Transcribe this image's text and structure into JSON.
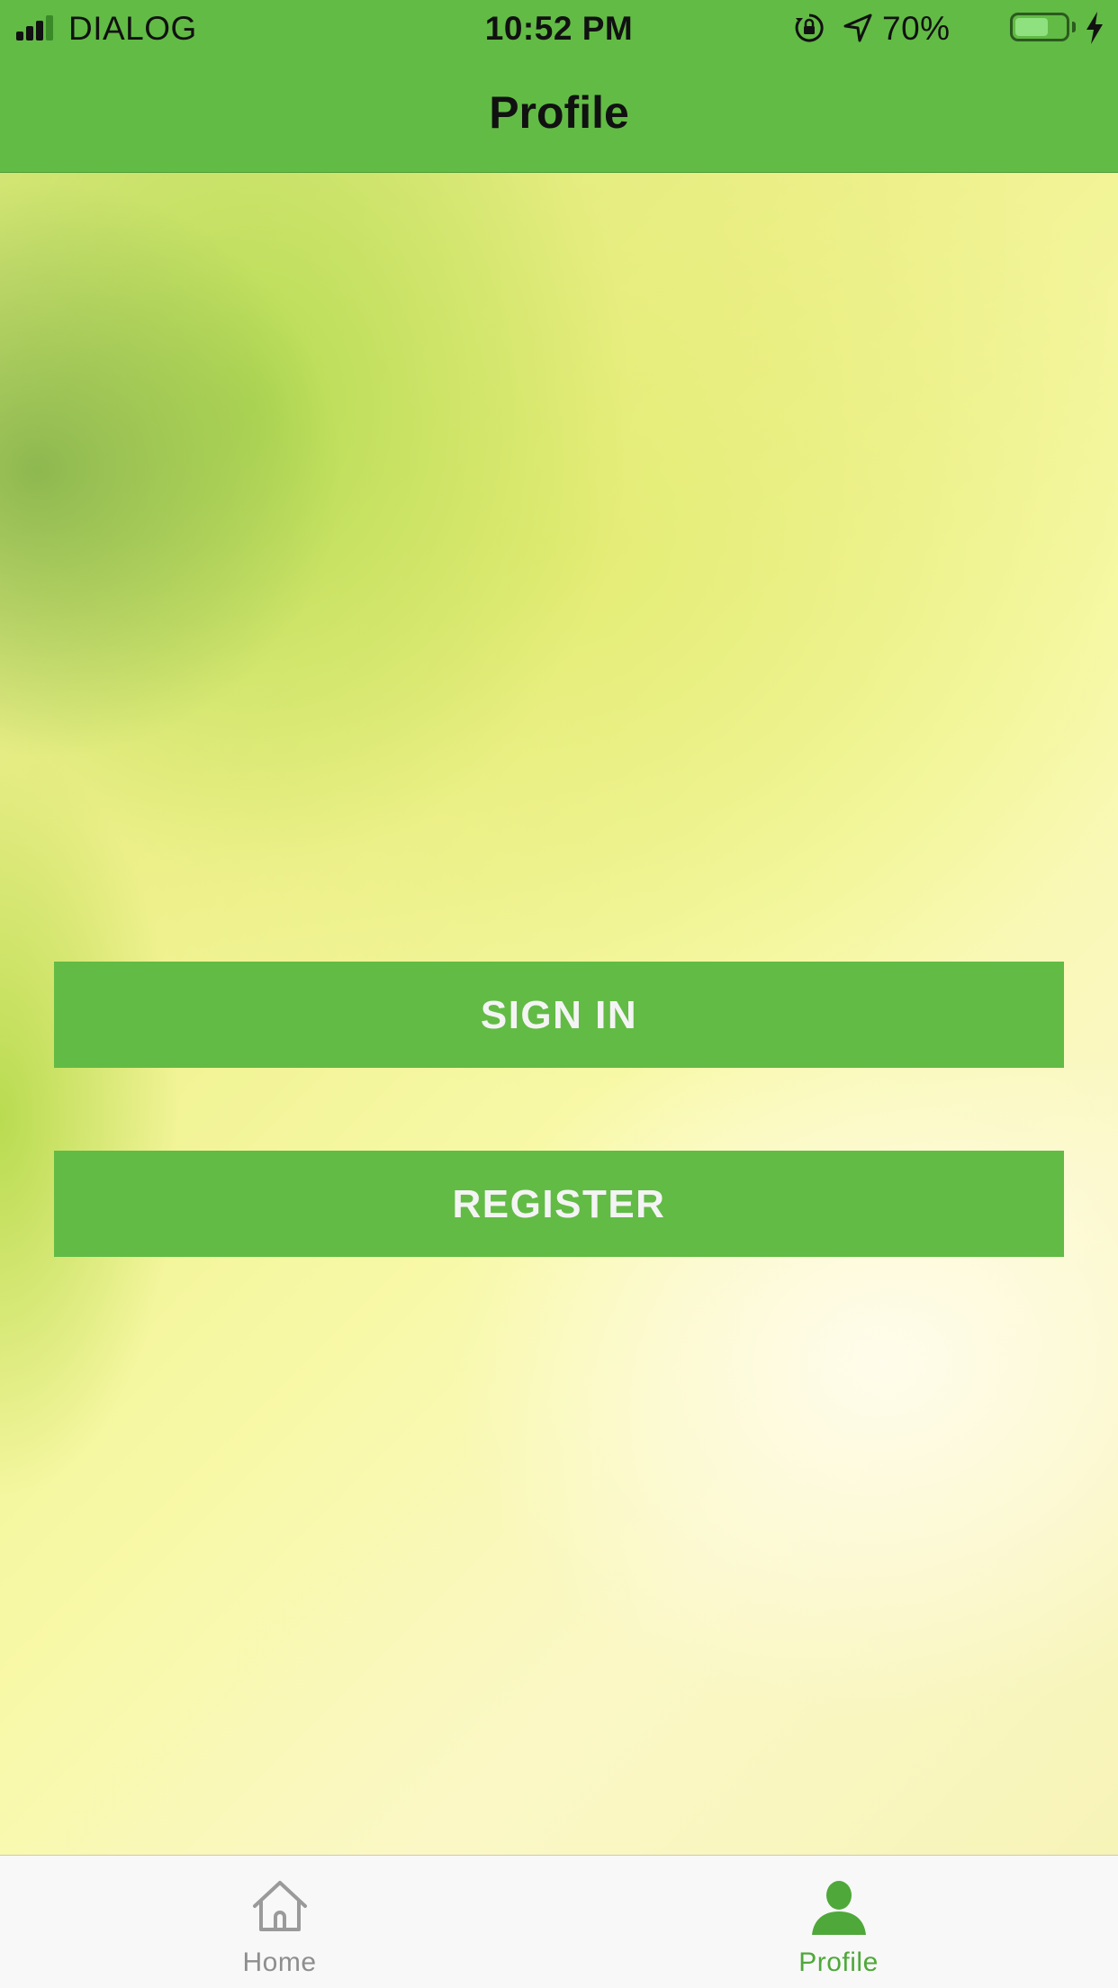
{
  "status_bar": {
    "carrier": "DIALOG",
    "time": "10:52 PM",
    "battery_percent": "70%",
    "battery_level": 0.7,
    "icons": [
      "signal-icon",
      "orientation-lock-icon",
      "location-arrow-icon",
      "battery-icon",
      "charging-bolt-icon"
    ]
  },
  "header": {
    "title": "Profile",
    "background_color": "#62bb45"
  },
  "actions": {
    "sign_in_label": "SIGN IN",
    "register_label": "REGISTER",
    "button_color": "#62bb45"
  },
  "tab_bar": {
    "tabs": [
      {
        "label": "Home",
        "icon": "home-icon",
        "active": false
      },
      {
        "label": "Profile",
        "icon": "user-icon",
        "active": true
      }
    ],
    "active_color": "#4fa83a",
    "inactive_color": "#8e8e8e"
  }
}
